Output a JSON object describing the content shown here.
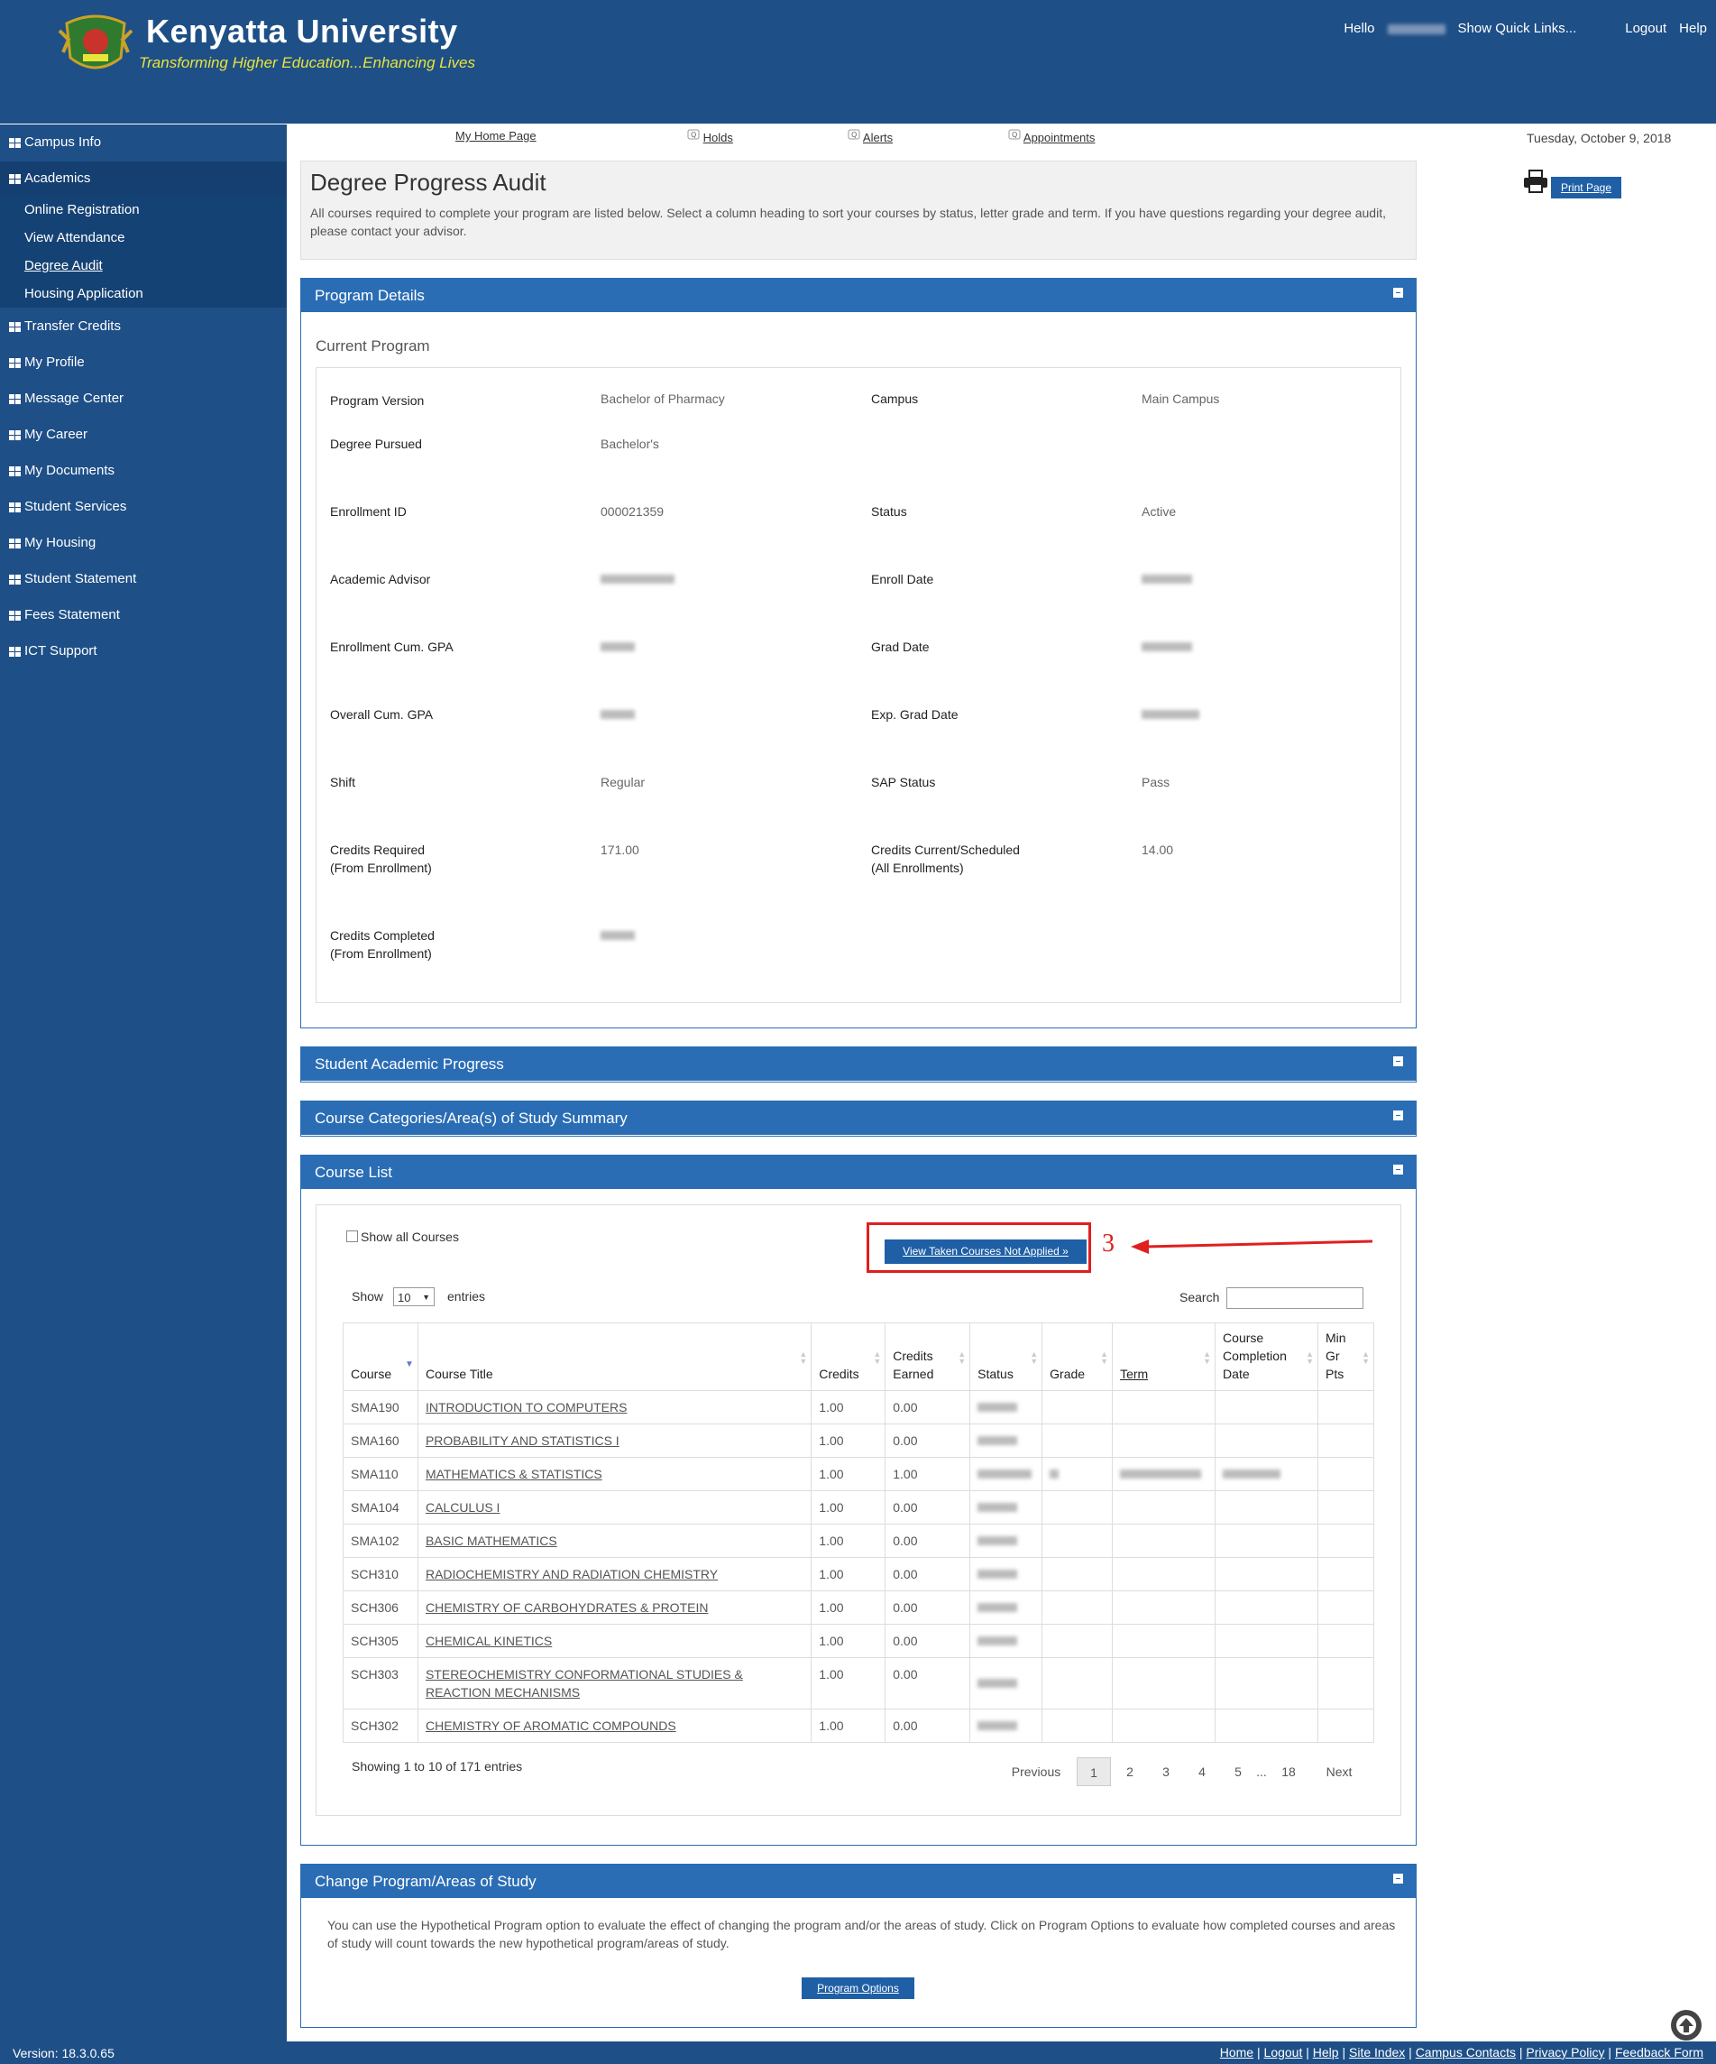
{
  "header": {
    "brand_name": "Kenyatta University",
    "tagline": "Transforming Higher Education...Enhancing Lives",
    "hello": "Hello",
    "quick_links": "Show Quick Links...",
    "logout": "Logout",
    "help": "Help"
  },
  "sidebar": {
    "items": [
      {
        "label": "Campus Info"
      },
      {
        "label": "Academics"
      },
      {
        "label": "Transfer Credits"
      },
      {
        "label": "My Profile"
      },
      {
        "label": "Message Center"
      },
      {
        "label": "My Career"
      },
      {
        "label": "My Documents"
      },
      {
        "label": "Student Services"
      },
      {
        "label": "My Housing"
      },
      {
        "label": "Student Statement"
      },
      {
        "label": "Fees Statement"
      },
      {
        "label": "ICT Support"
      }
    ],
    "academics_sub": [
      {
        "label": "Online Registration"
      },
      {
        "label": "View Attendance"
      },
      {
        "label": "Degree Audit"
      },
      {
        "label": "Housing Application"
      }
    ]
  },
  "topnav": {
    "home": "My Home Page",
    "holds": "Holds",
    "alerts": "Alerts",
    "appointments": "Appointments",
    "date": "Tuesday, October 9, 2018",
    "print": "Print Page"
  },
  "intro": {
    "title": "Degree Progress Audit",
    "text": "All courses required to complete your program are listed below. Select a column heading to sort your courses by status, letter grade and term. If you have questions regarding your degree audit, please contact your advisor."
  },
  "program": {
    "panel_title": "Program Details",
    "current_program": "Current Program",
    "program_version_label": "Program Version",
    "program_version": "Bachelor of Pharmacy",
    "campus_label": "Campus",
    "campus": "Main Campus",
    "degree_label": "Degree Pursued",
    "degree": "Bachelor's",
    "enrollment_id_label": "Enrollment ID",
    "enrollment_id": "000021359",
    "status_label": "Status",
    "status": "Active",
    "advisor_label": "Academic Advisor",
    "enroll_date_label": "Enroll Date",
    "enroll_gpa_label": "Enrollment Cum. GPA",
    "grad_date_label": "Grad Date",
    "overall_gpa_label": "Overall Cum. GPA",
    "exp_grad_label": "Exp. Grad Date",
    "shift_label": "Shift",
    "shift": "Regular",
    "sap_label": "SAP Status",
    "sap": "Pass",
    "credits_required_label": "Credits Required",
    "credits_required_sub": "(From Enrollment)",
    "credits_required": "171.00",
    "credits_current_label": "Credits Current/Scheduled",
    "credits_current_sub": "(All Enrollments)",
    "credits_current": "14.00",
    "credits_completed_label": "Credits Completed",
    "credits_completed_sub": "(From Enrollment)"
  },
  "panels": {
    "academic_progress": "Student Academic Progress",
    "categories": "Course Categories/Area(s) of Study Summary",
    "course_list": "Course List",
    "change_program": "Change Program/Areas of Study"
  },
  "course_list": {
    "show_all": "Show all Courses",
    "view_taken": "View Taken Courses Not Applied »",
    "annotation_number": "3",
    "show": "Show",
    "entries_value": "10",
    "entries": "entries",
    "search": "Search",
    "columns": {
      "course": "Course",
      "title": "Course Title",
      "credits": "Credits",
      "credits_earned_1": "Credits",
      "credits_earned_2": "Earned",
      "status": "Status",
      "grade": "Grade",
      "term": "Term",
      "completion_1": "Course",
      "completion_2": "Completion",
      "completion_3": "Date",
      "min_1": "Min",
      "min_2": "Gr",
      "min_3": "Pts"
    },
    "rows": [
      {
        "code": "SMA190",
        "title": "INTRODUCTION TO COMPUTERS",
        "credits": "1.00",
        "earned": "0.00"
      },
      {
        "code": "SMA160",
        "title": "PROBABILITY AND STATISTICS I",
        "credits": "1.00",
        "earned": "0.00"
      },
      {
        "code": "SMA110",
        "title": "MATHEMATICS & STATISTICS",
        "credits": "1.00",
        "earned": "1.00"
      },
      {
        "code": "SMA104",
        "title": "CALCULUS I",
        "credits": "1.00",
        "earned": "0.00"
      },
      {
        "code": "SMA102",
        "title": "BASIC MATHEMATICS",
        "credits": "1.00",
        "earned": "0.00"
      },
      {
        "code": "SCH310",
        "title": "RADIOCHEMISTRY AND RADIATION CHEMISTRY",
        "credits": "1.00",
        "earned": "0.00"
      },
      {
        "code": "SCH306",
        "title": "CHEMISTRY OF CARBOHYDRATES & PROTEIN",
        "credits": "1.00",
        "earned": "0.00"
      },
      {
        "code": "SCH305",
        "title": "CHEMICAL KINETICS",
        "credits": "1.00",
        "earned": "0.00"
      },
      {
        "code": "SCH303",
        "title": "STEREOCHEMISTRY CONFORMATIONAL STUDIES & REACTION MECHANISMS",
        "credits": "1.00",
        "earned": "0.00"
      },
      {
        "code": "SCH302",
        "title": "CHEMISTRY OF AROMATIC COMPOUNDS",
        "credits": "1.00",
        "earned": "0.00"
      }
    ],
    "showing": "Showing 1 to 10 of 171 entries",
    "pager": {
      "previous": "Previous",
      "p1": "1",
      "p2": "2",
      "p3": "3",
      "p4": "4",
      "p5": "5",
      "ellipsis": "...",
      "p18": "18",
      "next": "Next"
    }
  },
  "change_program": {
    "text": "You can use the Hypothetical Program option to evaluate the effect of changing the program and/or the areas of study. Click on Program Options to evaluate how completed courses and areas of study will count towards the new hypothetical program/areas of study.",
    "button": "Program Options"
  },
  "footer": {
    "version": "Version: 18.3.0.65",
    "home": "Home",
    "logout": "Logout",
    "help": "Help",
    "site_index": "Site Index",
    "campus_contacts": "Campus Contacts",
    "privacy": "Privacy Policy",
    "feedback": "Feedback Form"
  },
  "colors": {
    "brand_blue": "#1e4f87",
    "panel_blue": "#2a6db5",
    "tagline_yellow": "#e9e43a",
    "annotation_red": "#e01f1f"
  }
}
